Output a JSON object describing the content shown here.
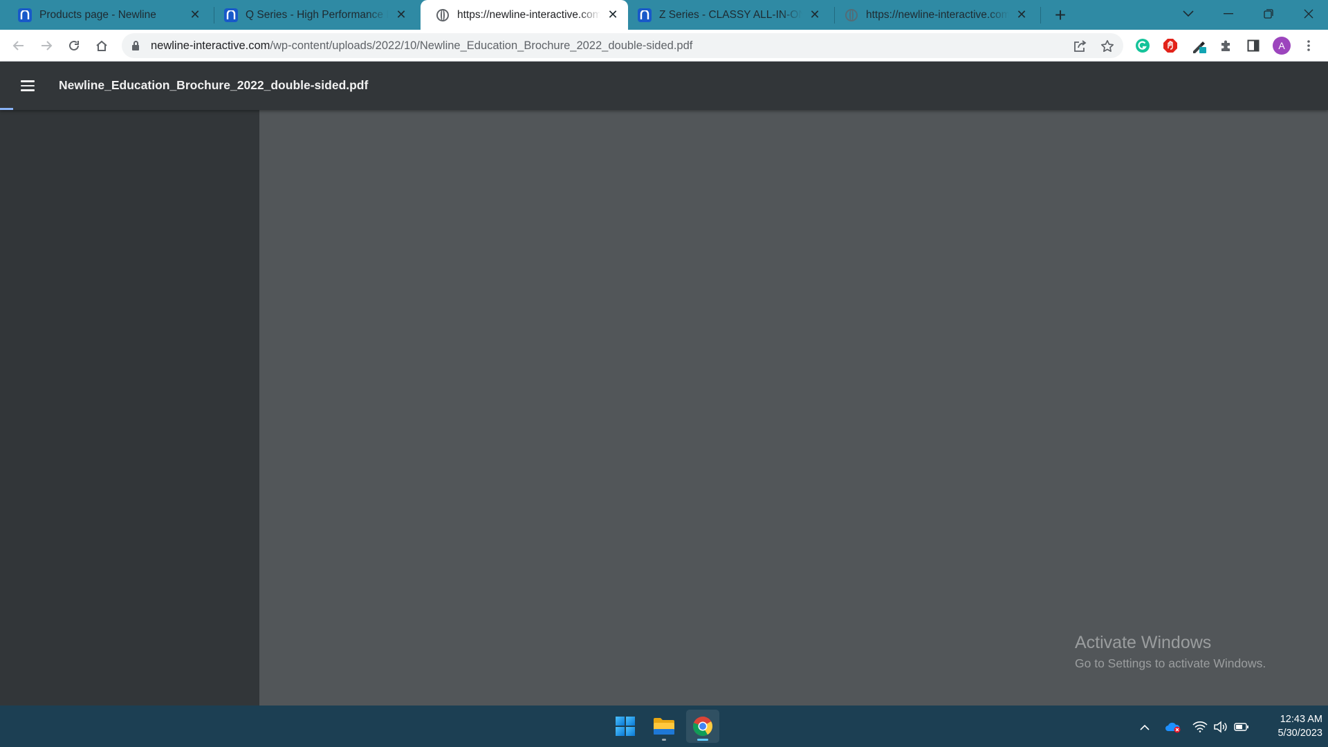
{
  "browser": {
    "tabs": [
      {
        "title": "Products page - Newline",
        "favicon": "newline-logo-icon",
        "active": false
      },
      {
        "title": "Q Series - High Performance Interactive",
        "favicon": "newline-logo-icon",
        "active": false
      },
      {
        "title": "https://newline-interactive.com/wp-content",
        "favicon": "globe-icon",
        "active": true
      },
      {
        "title": "Z Series - CLASSY ALL-IN-ONE COLLABORATION",
        "favicon": "newline-logo-icon",
        "active": false
      },
      {
        "title": "https://newline-interactive.com/wp-content",
        "favicon": "globe-icon",
        "active": false
      }
    ],
    "url_host": "newline-interactive.com",
    "url_path": "/wp-content/uploads/2022/10/Newline_Education_Brochure_2022_double-sided.pdf",
    "profile_initial": "A",
    "colors": {
      "tabstrip": "#2f8aa4",
      "toolbar": "#ffffff",
      "avatar": "#9c45bd"
    }
  },
  "pdf_viewer": {
    "file_name": "Newline_Education_Brochure_2022_double-sided.pdf",
    "colors": {
      "header": "#323639",
      "background": "#525659",
      "progress": "#8ab4f8"
    }
  },
  "watermark": {
    "title": "Activate Windows",
    "subtitle": "Go to Settings to activate Windows."
  },
  "taskbar": {
    "apps": [
      "start-button",
      "file-explorer",
      "chrome"
    ],
    "time": "12:43 AM",
    "date": "5/30/2023",
    "colors": {
      "background": "#1c3f53"
    }
  }
}
